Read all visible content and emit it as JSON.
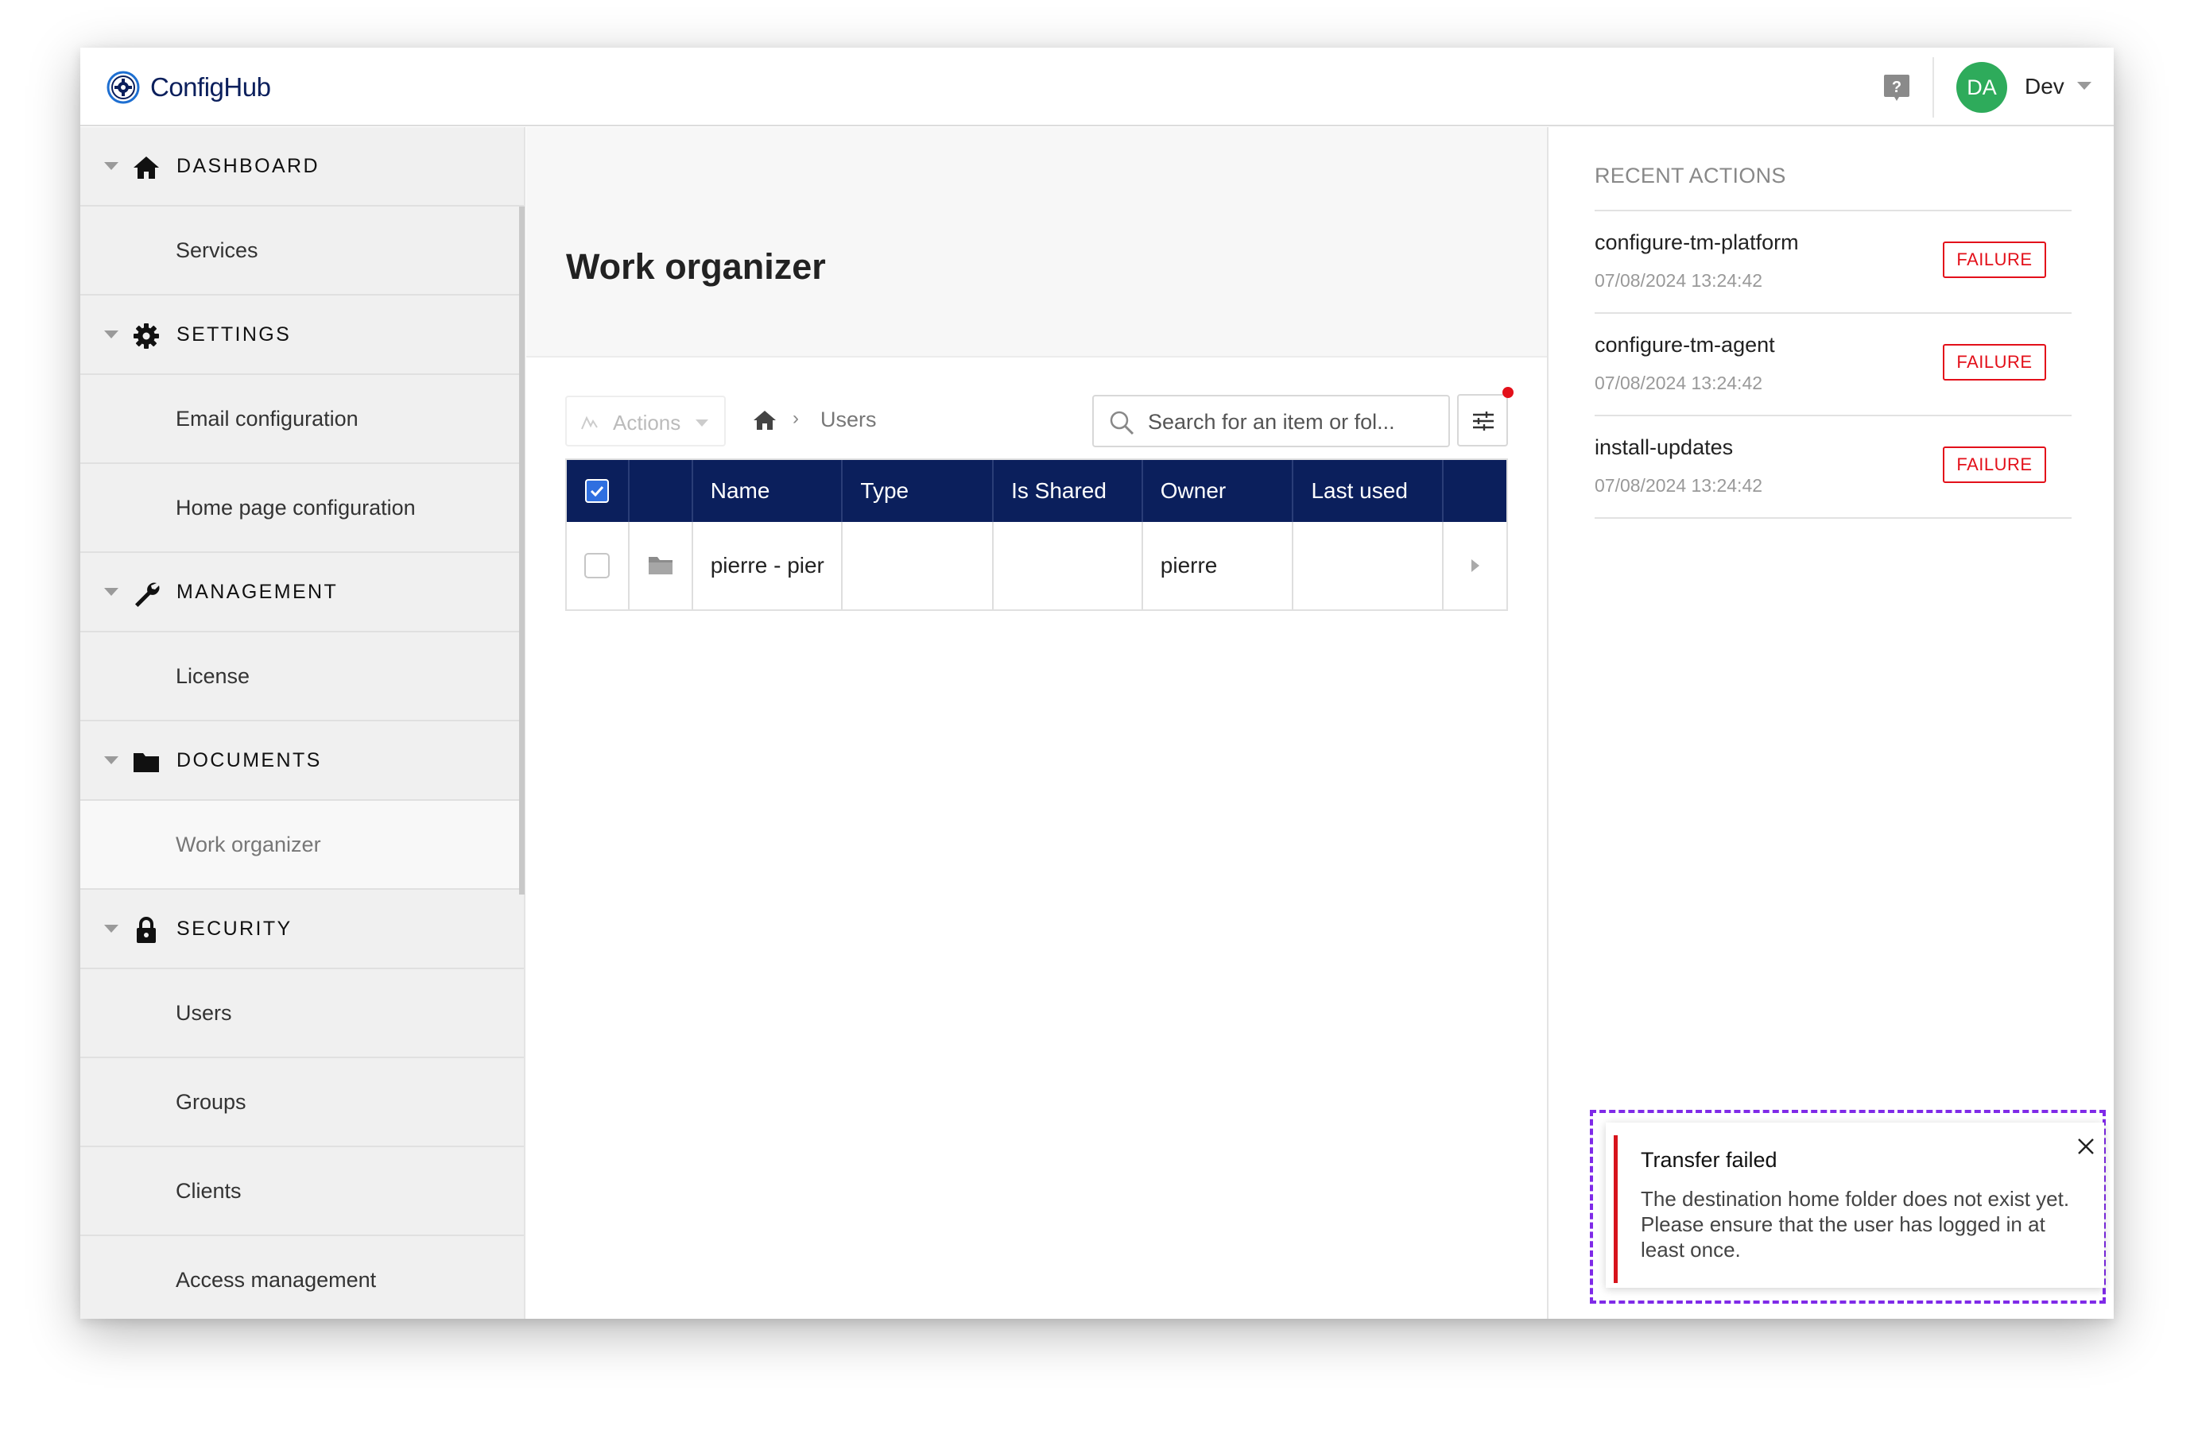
{
  "header": {
    "logo_text": "ConfigHub",
    "avatar_initials": "DA",
    "user_name": "Dev"
  },
  "sidebar": {
    "sections": [
      {
        "label": "DASHBOARD",
        "icon": "home-icon",
        "items": [
          "Services"
        ]
      },
      {
        "label": "SETTINGS",
        "icon": "gear-icon",
        "items": [
          "Email configuration",
          "Home page configuration"
        ]
      },
      {
        "label": "MANAGEMENT",
        "icon": "wrench-icon",
        "items": [
          "License"
        ]
      },
      {
        "label": "DOCUMENTS",
        "icon": "folder-icon",
        "items": [
          "Work organizer"
        ]
      },
      {
        "label": "SECURITY",
        "icon": "lock-icon",
        "items": [
          "Users",
          "Groups",
          "Clients",
          "Access management"
        ]
      }
    ],
    "active_item": "Work organizer"
  },
  "main": {
    "title": "Work organizer",
    "actions_label": "Actions",
    "breadcrumb": {
      "current": "Users",
      "separator": "›"
    },
    "search": {
      "placeholder": "Search for an item or fol..."
    },
    "table": {
      "columns": [
        "Name",
        "Type",
        "Is Shared",
        "Owner",
        "Last used"
      ],
      "rows": [
        {
          "name": "pierre - pier",
          "type": "",
          "is_shared": "",
          "owner": "pierre",
          "last_used": "",
          "icon": "folder-icon"
        }
      ]
    }
  },
  "recent_actions": {
    "title": "RECENT ACTIONS",
    "items": [
      {
        "name": "configure-tm-platform",
        "time": "07/08/2024 13:24:42",
        "status": "FAILURE"
      },
      {
        "name": "configure-tm-agent",
        "time": "07/08/2024 13:24:42",
        "status": "FAILURE"
      },
      {
        "name": "install-updates",
        "time": "07/08/2024 13:24:42",
        "status": "FAILURE"
      }
    ]
  },
  "toast": {
    "title": "Transfer failed",
    "message": "The destination home folder does not exist yet. Please ensure that the user has logged in at least once."
  },
  "colors": {
    "brand_navy": "#0b1f5c",
    "avatar_green": "#2eab5b",
    "failure_red": "#e3101a",
    "checkbox_blue": "#2f6fe0",
    "highlight_purple": "#7f2ae8"
  }
}
